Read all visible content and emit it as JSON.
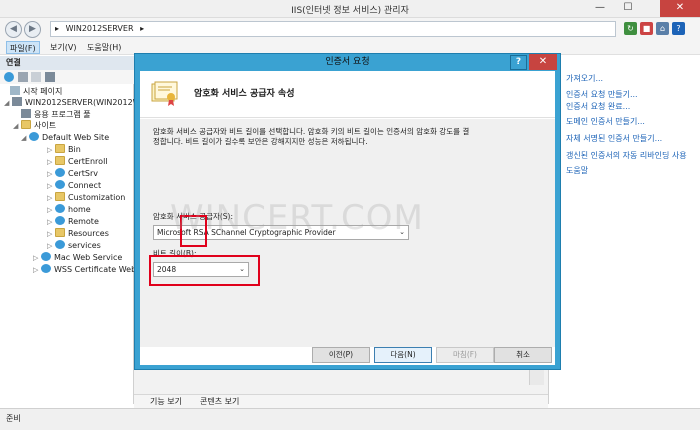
{
  "window": {
    "title": "IIS(인터넷 정보 서비스) 관리자",
    "minimize": "—",
    "maximize": "☐",
    "close": "✕"
  },
  "address": {
    "back": "◀",
    "forward": "▶",
    "path_sep": "▸",
    "path": "WIN2012SERVER",
    "path_tail": "▸"
  },
  "menu": {
    "file": "파일(F)",
    "view": "보기(V)",
    "help": "도움말(H)"
  },
  "connections": {
    "header": "연결",
    "tree": [
      {
        "label": "시작 페이지",
        "icon": "home-icon"
      },
      {
        "label": "WIN2012SERVER(WIN2012W",
        "icon": "server-icon"
      },
      {
        "label": "응용 프로그램 풀",
        "icon": "app-pool-icon"
      },
      {
        "label": "사이트",
        "icon": "sites-folder-icon"
      },
      {
        "label": "Default Web Site",
        "icon": "globe-icon"
      },
      {
        "label": "Bin",
        "icon": "folder-icon"
      },
      {
        "label": "CertEnroll",
        "icon": "folder-icon"
      },
      {
        "label": "CertSrv",
        "icon": "app-icon"
      },
      {
        "label": "Connect",
        "icon": "app-icon"
      },
      {
        "label": "Customization",
        "icon": "folder-icon"
      },
      {
        "label": "home",
        "icon": "app-icon"
      },
      {
        "label": "Remote",
        "icon": "app-icon"
      },
      {
        "label": "Resources",
        "icon": "folder-icon"
      },
      {
        "label": "services",
        "icon": "app-icon"
      },
      {
        "label": "Mac Web Service",
        "icon": "globe-icon"
      },
      {
        "label": "WSS Certificate Web",
        "icon": "globe-icon"
      }
    ]
  },
  "actions": {
    "items": [
      "가져오기...",
      "인증서 요청 만들기...",
      "인증서 요청 완료...",
      "도메인 인증서 만들기...",
      "자체 서명된 인증서 만들기...",
      "갱신된 인증서의 자동 리바인딩 사용",
      "도움말"
    ]
  },
  "view_tabs": {
    "features": "기능 보기",
    "content": "콘텐츠 보기"
  },
  "status": {
    "text": "준비"
  },
  "dialog": {
    "title": "인증서 요청",
    "help": "?",
    "close": "✕",
    "heading": "암호화 서비스 공급자 속성",
    "description": "암호화 서비스 공급자와 비트 길이를 선택합니다. 암호화 키의 비트 길이는 인증서의 암호화 강도를 결정합니다. 비트 길이가 길수록 보안은 강해지지만 성능은 저하됩니다.",
    "provider_label": "암호화 서비스 공급자(S):",
    "provider_value": "Microsoft RSA SChannel Cryptographic Provider",
    "bitlength_label": "비트 길이(B):",
    "bitlength_value": "2048",
    "buttons": {
      "prev": "이전(P)",
      "next": "다음(N)",
      "finish": "마침(F)",
      "cancel": "취소"
    },
    "watermark": "WINCERT.COM"
  },
  "colors": {
    "dialog_frame": "#3aa2d2",
    "highlight_box": "#e0001b",
    "link": "#1c63b7",
    "close_button": "#c74440"
  }
}
